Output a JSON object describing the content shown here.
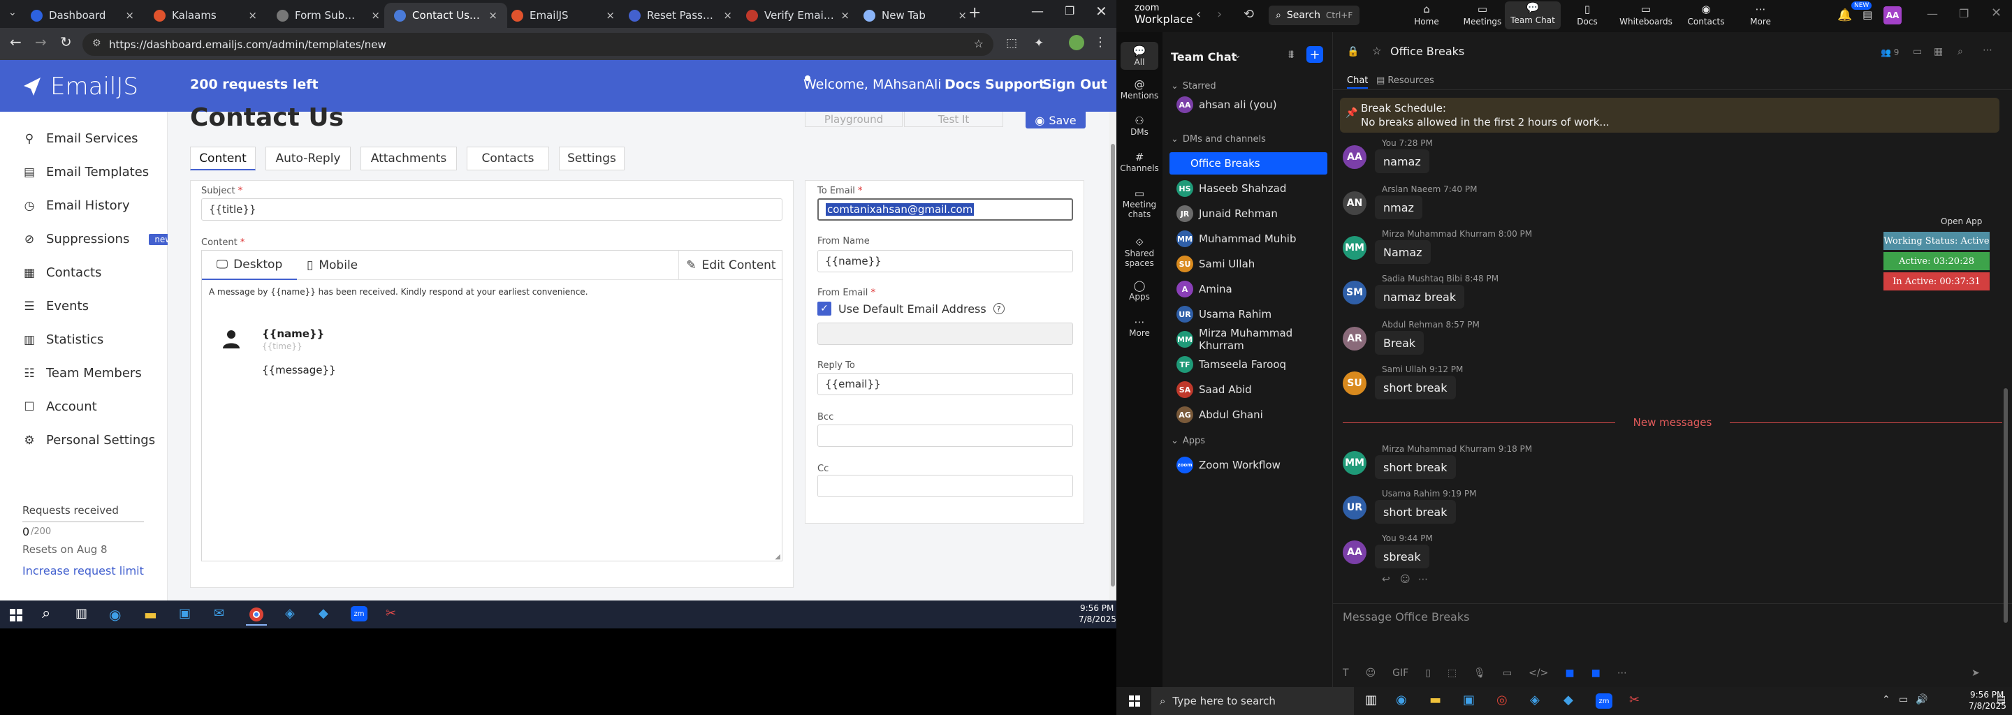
{
  "browser": {
    "tabs": [
      {
        "label": "Dashboard",
        "color": "#2d62e0"
      },
      {
        "label": "Kalaams",
        "color": "#e0532d"
      },
      {
        "label": "Form Submission",
        "color": "#777"
      },
      {
        "label": "Contact Us - Emai",
        "color": "#4a7bd9"
      },
      {
        "label": "EmailJS",
        "color": "#e0532d"
      },
      {
        "label": "Reset Password -",
        "color": "#4361cf"
      },
      {
        "label": "Verify Email - con",
        "color": "#c0392b"
      },
      {
        "label": "New Tab",
        "color": "#8ab4f8"
      }
    ],
    "close_glyph": "×",
    "new_tab_glyph": "+",
    "url": "https://dashboard.emailjs.com/admin/templates/new"
  },
  "emailjs": {
    "brand": "EmailJS",
    "requests_left": "200 requests left",
    "welcome": "Welcome,  MAhsanAli",
    "nav": {
      "docs": "Docs",
      "support": "Support",
      "signout": "Sign Out"
    },
    "sidebar": [
      {
        "label": "Email Services",
        "icon": "plug-icon"
      },
      {
        "label": "Email Templates",
        "icon": "template-icon"
      },
      {
        "label": "Email History",
        "icon": "history-icon"
      },
      {
        "label": "Suppressions",
        "icon": "block-icon",
        "badge": "new"
      },
      {
        "label": "Contacts",
        "icon": "contacts-icon"
      },
      {
        "label": "Events",
        "icon": "list-icon"
      },
      {
        "label": "Statistics",
        "icon": "chart-icon"
      },
      {
        "label": "Team Members",
        "icon": "team-icon"
      },
      {
        "label": "Account",
        "icon": "user-icon"
      },
      {
        "label": "Personal Settings",
        "icon": "gear-icon"
      }
    ],
    "requests_received": "Requests received",
    "req_count": "0",
    "req_total": "/200",
    "req_fraction": 0.0,
    "resets": "Resets on Aug 8",
    "increase": "Increase request limit",
    "page_title": "Contact Us",
    "playground": "Playground",
    "test_it": "Test It",
    "save": "Save",
    "tabs": [
      "Content",
      "Auto-Reply",
      "Attachments",
      "Contacts",
      "Settings"
    ],
    "subject_label": "Subject",
    "subject_value": "{{title}}",
    "content_label": "Content",
    "desktop": "Desktop",
    "mobile": "Mobile",
    "edit_content": "Edit Content",
    "preview_text": "A message by {{name}} has been received. Kindly respond at your earliest convenience.",
    "preview_name": "{{name}}",
    "preview_time": "{{time}}",
    "preview_message": "{{message}}",
    "to_email_label": "To Email",
    "to_email_value": "comtanixahsan@gmail.com",
    "from_name_label": "From Name",
    "from_name_value": "{{name}}",
    "from_email_label": "From Email",
    "use_default": "Use Default Email Address",
    "reply_to_label": "Reply To",
    "reply_to_value": "{{email}}",
    "bcc_label": "Bcc",
    "cc_label": "Cc",
    "required_mark": "*"
  },
  "taskbar_left": {
    "time": "9:56 PM",
    "date": "7/8/2025"
  },
  "zoom": {
    "brand_line1": "zoom",
    "brand_line2": "Workplace",
    "search": "Search",
    "search_shortcut": "Ctrl+F",
    "top_tabs": [
      "Home",
      "Meetings",
      "Team Chat",
      "Docs",
      "Whiteboards",
      "Contacts",
      "More"
    ],
    "more_badge": "NEW",
    "user_initials": "AA",
    "rail": [
      "All",
      "Mentions",
      "DMs",
      "Channels",
      "Meeting chats",
      "Shared spaces",
      "Apps",
      "More"
    ],
    "rail_multi": {
      "meeting_1": "Meeting",
      "meeting_2": "chats",
      "shared_1": "Shared",
      "shared_2": "spaces"
    },
    "list_title": "Team Chat",
    "starred": "Starred",
    "dms_channels": "DMs and channels",
    "apps": "Apps",
    "starred_items": [
      {
        "name": "ahsan ali (you)",
        "initials": "AA",
        "color": "#7b3fa8"
      }
    ],
    "dm_items": [
      {
        "name": "Office Breaks",
        "initials": "",
        "color": "#0b5cff",
        "selected": true
      },
      {
        "name": "Haseeb Shahzad",
        "initials": "HS",
        "color": "#1f9a78"
      },
      {
        "name": "Junaid Rehman",
        "initials": "JR",
        "color": "#6b6b6b"
      },
      {
        "name": "Muhammad Muhib",
        "initials": "MM",
        "color": "#2f5fa8"
      },
      {
        "name": "Sami Ullah",
        "initials": "SU",
        "color": "#d98a1e"
      },
      {
        "name": "Amina",
        "initials": "A",
        "color": "#8a3fb8"
      },
      {
        "name": "Usama Rahim",
        "initials": "UR",
        "color": "#2f5fa8"
      },
      {
        "name": "Mirza Muhammad Khurram",
        "initials": "MM",
        "color": "#1f9a78"
      },
      {
        "name": "Tamseela Farooq",
        "initials": "TF",
        "color": "#1f9a78"
      },
      {
        "name": "Saad Abid",
        "initials": "SA",
        "color": "#c0392b"
      },
      {
        "name": "Abdul Ghani",
        "initials": "AG",
        "color": "#7a5a3a"
      }
    ],
    "app_items": [
      {
        "name": "Zoom Workflow",
        "initials": "zoom",
        "color": "#0b5cff"
      }
    ],
    "channel_name": "Office Breaks",
    "member_count": "9",
    "chat_tab": "Chat",
    "resources_tab": "Resources",
    "pinned_title": "Break Schedule:",
    "pinned_text": "No breaks allowed in the first 2 hours of work...",
    "open_app": "Open App",
    "status_working": "Working Status: Active",
    "status_active": "Active: 03:20:28",
    "status_inactive": "In Active: 00:37:31",
    "new_messages": "New messages",
    "messages": [
      {
        "author": "You 7:28 PM",
        "text": "namaz",
        "initials": "AA",
        "color": "#7b3fa8"
      },
      {
        "author": "Arslan Naeem 7:40 PM",
        "text": "nmaz",
        "initials": "AN",
        "color": "#444"
      },
      {
        "author": "Mirza Muhammad Khurram 8:00 PM",
        "text": "Namaz",
        "initials": "MM",
        "color": "#1f9a78"
      },
      {
        "author": "Sadia Mushtaq Bibi 8:48 PM",
        "text": "namaz  break",
        "initials": "SM",
        "color": "#2f5fa8"
      },
      {
        "author": "Abdul Rehman 8:57 PM",
        "text": "Break",
        "initials": "AR",
        "color": "#8a6a7a"
      },
      {
        "author": "Sami Ullah 9:12 PM",
        "text": "short break",
        "initials": "SU",
        "color": "#d98a1e"
      },
      {
        "author": "Mirza Muhammad Khurram 9:18 PM",
        "text": "short break",
        "initials": "MM",
        "color": "#1f9a78"
      },
      {
        "author": "Usama Rahim 9:19 PM",
        "text": "short break",
        "initials": "UR",
        "color": "#2f5fa8"
      },
      {
        "author": "You 9:44 PM",
        "text": "sbreak",
        "initials": "AA",
        "color": "#7b3fa8"
      }
    ],
    "composer_placeholder": "Message Office Breaks"
  },
  "taskbar_right": {
    "search": "Type here to search",
    "time": "9:56 PM",
    "date": "7/8/2025"
  }
}
